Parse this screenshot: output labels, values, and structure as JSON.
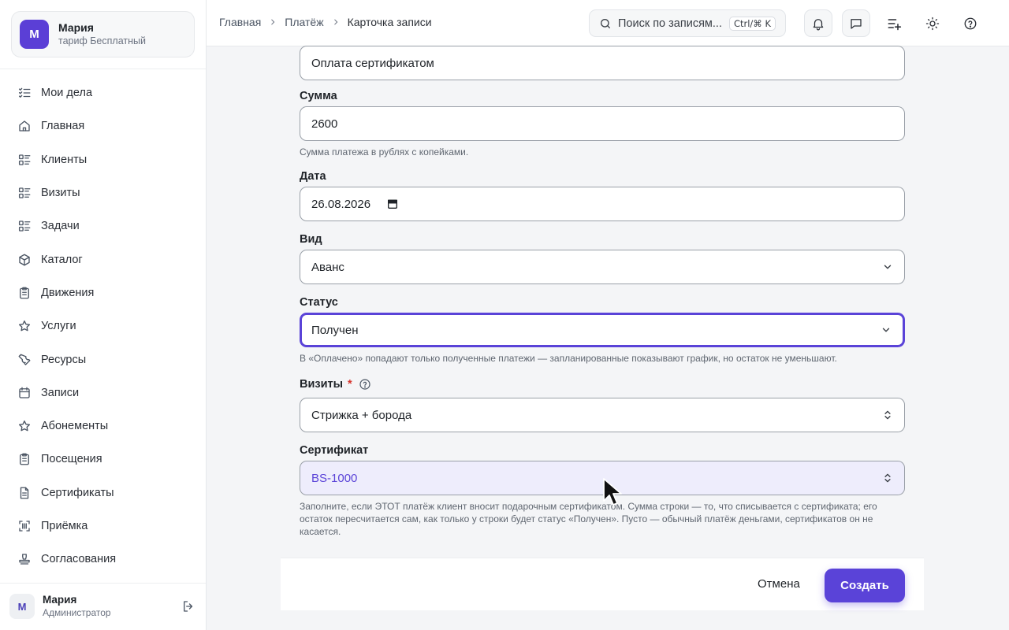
{
  "org": {
    "avatar_letter": "М",
    "name": "Мария",
    "plan": "тариф Бесплатный"
  },
  "nav": {
    "items": [
      {
        "label": "Мои дела",
        "icon": "list-check-icon"
      },
      {
        "label": "Главная",
        "icon": "home-icon"
      },
      {
        "label": "Клиенты",
        "icon": "list-detail-icon"
      },
      {
        "label": "Визиты",
        "icon": "list-detail-icon"
      },
      {
        "label": "Задачи",
        "icon": "list-detail-icon"
      },
      {
        "label": "Каталог",
        "icon": "box-icon"
      },
      {
        "label": "Движения",
        "icon": "clipboard-icon"
      },
      {
        "label": "Услуги",
        "icon": "star-icon"
      },
      {
        "label": "Ресурсы",
        "icon": "wrench-icon"
      },
      {
        "label": "Записи",
        "icon": "calendar-icon"
      },
      {
        "label": "Абонементы",
        "icon": "star-icon"
      },
      {
        "label": "Посещения",
        "icon": "clipboard-icon"
      },
      {
        "label": "Сертификаты",
        "icon": "document-icon"
      },
      {
        "label": "Приёмка",
        "icon": "barcode-scan-icon"
      },
      {
        "label": "Согласования",
        "icon": "stamp-icon"
      }
    ]
  },
  "user": {
    "avatar_letter": "М",
    "name": "Мария",
    "role": "Администратор"
  },
  "header": {
    "breadcrumbs": [
      "Главная",
      "Платёж",
      "Карточка записи"
    ],
    "search_placeholder": "Поиск по записям...",
    "search_shortcut": "Ctrl/⌘ K"
  },
  "form": {
    "name_value": "Оплата сертификатом",
    "amount": {
      "label": "Сумма",
      "value": "2600",
      "help": "Сумма платежа в рублях с копейками."
    },
    "date": {
      "label": "Дата",
      "value": "26.08.2026"
    },
    "kind": {
      "label": "Вид",
      "value": "Аванс"
    },
    "status": {
      "label": "Статус",
      "value": "Получен",
      "help": "В «Оплачено» попадают только полученные платежи — запланированные показывают график, но остаток не уменьшают."
    },
    "visits": {
      "label": "Визиты",
      "required_mark": "*",
      "value": "Стрижка + борода"
    },
    "certificate": {
      "label": "Сертификат",
      "value": "BS-1000",
      "help": "Заполните, если ЭТОТ платёж клиент вносит подарочным сертификатом. Сумма строки — то, что списывается с сертификата; его остаток пересчитается сам, как только у строки будет статус «Получен». Пусто — обычный платёж деньгами, сертификатов он не касается."
    }
  },
  "footer": {
    "cancel_label": "Отмена",
    "create_label": "Создать"
  },
  "colors": {
    "accent": "#5a43d8",
    "required": "#d6342c"
  }
}
